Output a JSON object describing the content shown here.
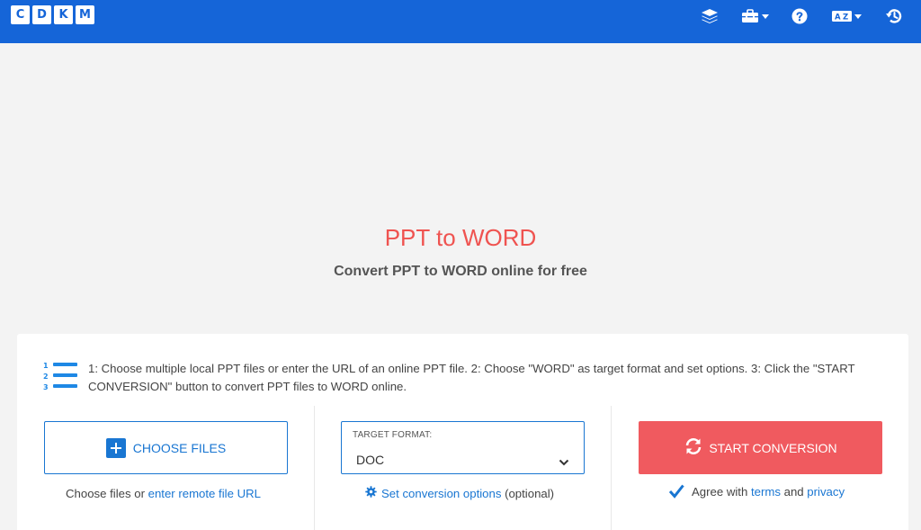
{
  "header": {
    "logo_letters": [
      "C",
      "D",
      "K",
      "M"
    ],
    "icons": [
      "layers-icon",
      "toolbox-icon",
      "help-icon",
      "language-icon",
      "history-icon"
    ],
    "brand_color": "#1565d8"
  },
  "hero": {
    "title": "PPT to WORD",
    "subtitle": "Convert PPT to WORD online for free",
    "title_color": "#ef5350"
  },
  "steps": {
    "text": "1: Choose multiple local PPT files or enter the URL of an online PPT file. 2: Choose \"WORD\" as target format and set options. 3: Click the \"START CONVERSION\" button to convert PPT files to WORD online."
  },
  "upload": {
    "choose_label": "CHOOSE FILES",
    "choose_prefix": "Choose files or ",
    "remote_link": "enter remote file URL"
  },
  "format": {
    "label": "TARGET FORMAT:",
    "value": "DOC",
    "options_link": "Set conversion options",
    "options_suffix": " (optional)"
  },
  "convert": {
    "start_label": "START CONVERSION",
    "agree_prefix": "Agree with ",
    "terms_link": "terms",
    "and_text": " and ",
    "privacy_link": "privacy",
    "agreed": true,
    "button_color": "#f05a5f"
  }
}
